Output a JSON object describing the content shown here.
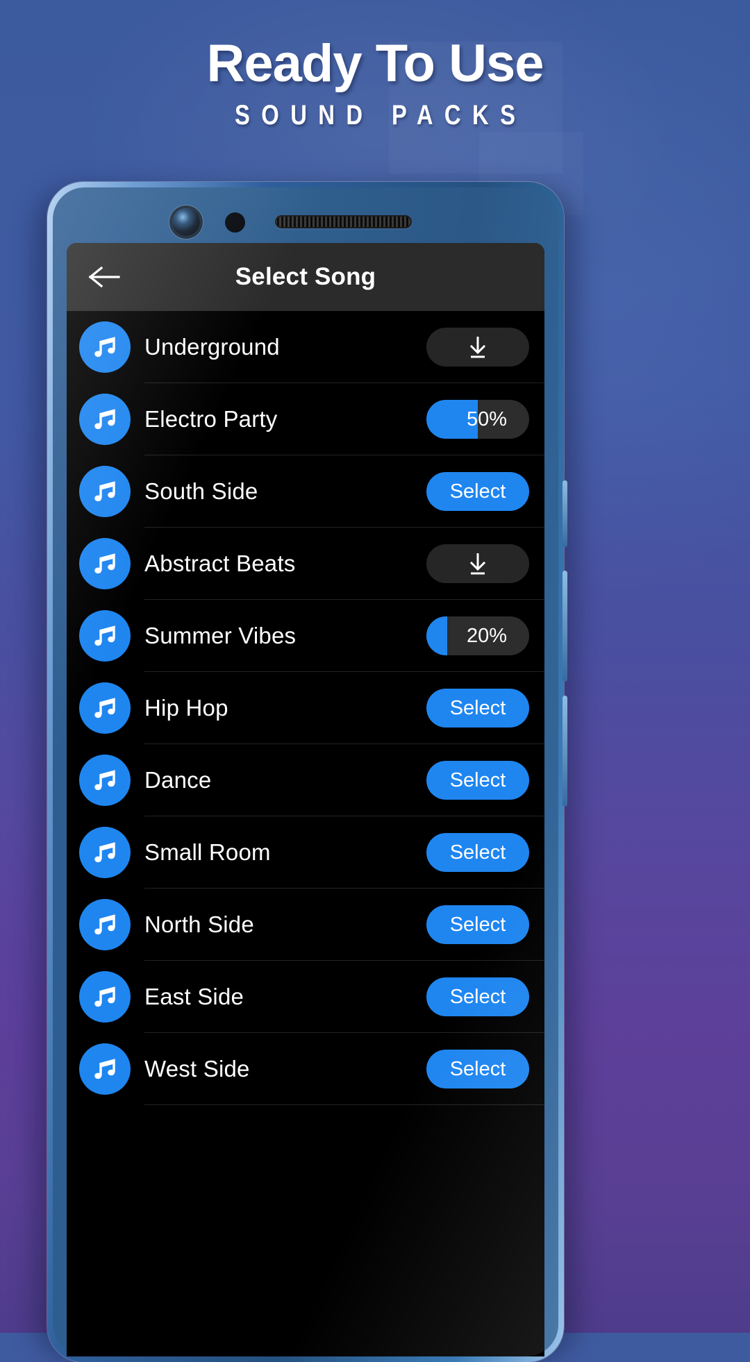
{
  "promo": {
    "title": "Ready To Use",
    "subtitle": "SOUND PACKS"
  },
  "colors": {
    "accent": "#1f86f0",
    "appbar": "#2b2b2b",
    "screen_bg": "#000000",
    "download_pill": "#262626",
    "progress_track": "#2d2d2d",
    "separator": "#232323"
  },
  "app": {
    "title": "Select Song",
    "back_icon": "arrow-left-icon"
  },
  "device": {
    "camera_icon": "front-camera-icon",
    "sensor_icon": "proximity-sensor-icon",
    "earpiece_icon": "earpiece-speaker-icon"
  },
  "labels": {
    "select": "Select",
    "download_icon": "download-icon",
    "note_icon": "music-note-icon"
  },
  "songs": [
    {
      "name": "Underground",
      "action": "download"
    },
    {
      "name": "Electro Party",
      "action": "progress",
      "percent": 50,
      "percent_label": "50%"
    },
    {
      "name": "South Side",
      "action": "select",
      "button_label": "Select"
    },
    {
      "name": "Abstract Beats",
      "action": "download"
    },
    {
      "name": "Summer Vibes",
      "action": "progress",
      "percent": 20,
      "percent_label": "20%"
    },
    {
      "name": "Hip Hop",
      "action": "select",
      "button_label": "Select"
    },
    {
      "name": "Dance",
      "action": "select",
      "button_label": "Select"
    },
    {
      "name": "Small Room",
      "action": "select",
      "button_label": "Select"
    },
    {
      "name": "North Side",
      "action": "select",
      "button_label": "Select"
    },
    {
      "name": "East Side",
      "action": "select",
      "button_label": "Select"
    },
    {
      "name": "West Side",
      "action": "select",
      "button_label": "Select"
    }
  ]
}
